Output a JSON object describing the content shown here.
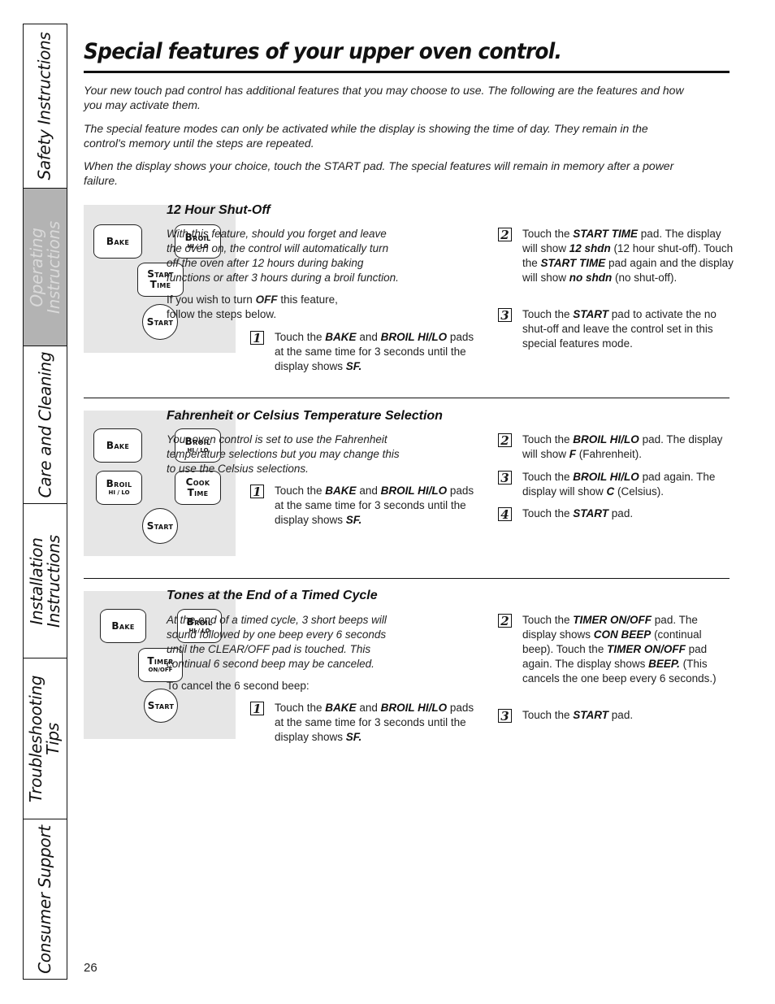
{
  "sidebar": {
    "tabs": [
      {
        "label": "Safety Instructions",
        "active": false
      },
      {
        "label": "Operating\nInstructions",
        "active": true
      },
      {
        "label": "Care and Cleaning",
        "active": false
      },
      {
        "label": "Installation\nInstructions",
        "active": false
      },
      {
        "label": "Troubleshooting\nTips",
        "active": false
      },
      {
        "label": "Consumer Support",
        "active": false
      }
    ]
  },
  "header": {
    "title": "Special features of your upper oven control."
  },
  "intro": {
    "p1": "Your new touch pad control has additional features that you may choose to use. The following are the features and how you may activate them.",
    "p2": "The special feature modes can only be activated while the display is showing the time of day. They remain in the control's memory until the steps are repeated.",
    "p3": "When the display shows your choice, touch the START pad. The special features will remain in memory after a power failure."
  },
  "sections": [
    {
      "title": "12 Hour Shut-Off",
      "pads": [
        {
          "main": "Bake",
          "sub": ""
        },
        {
          "main": "Broil",
          "sub": "HI / LO"
        },
        {
          "main": "Start Time",
          "sub": ""
        },
        {
          "main": "Start",
          "sub": ""
        }
      ],
      "description": "With this feature, should you forget and leave the oven on, the control will automatically turn off the oven after 12 hours during baking functions or after 3 hours during a broil function.",
      "note_pre": "If you wish to turn ",
      "note_bold": "OFF",
      "note_post": " this feature, follow the steps below.",
      "steps": [
        {
          "num": "1",
          "parts": [
            [
              "Touch the ",
              false
            ],
            [
              "BAKE",
              true
            ],
            [
              " and ",
              false
            ],
            [
              "BROIL HI/LO",
              true
            ],
            [
              " pads at the same time for 3 seconds until the display shows ",
              false
            ],
            [
              "SF.",
              true
            ]
          ]
        },
        {
          "num": "2",
          "parts": [
            [
              "Touch the ",
              false
            ],
            [
              "START TIME",
              true
            ],
            [
              " pad. The display will show ",
              false
            ],
            [
              "12 shdn",
              true
            ],
            [
              " (12 hour shut-off). Touch the ",
              false
            ],
            [
              "START TIME",
              true
            ],
            [
              " pad again and the display will show ",
              false
            ],
            [
              "no shdn",
              true
            ],
            [
              " (no shut-off).",
              false
            ]
          ]
        },
        {
          "num": "3",
          "parts": [
            [
              "Touch the ",
              false
            ],
            [
              "START",
              true
            ],
            [
              " pad to activate the no shut-off and leave the control set in this special features mode.",
              false
            ]
          ]
        }
      ]
    },
    {
      "title": "Fahrenheit or Celsius Temperature Selection",
      "pads": [
        {
          "main": "Bake",
          "sub": ""
        },
        {
          "main": "Broil",
          "sub": "HI / LO"
        },
        {
          "main": "Broil",
          "sub": "HI / LO"
        },
        {
          "main": "Cook Time",
          "sub": ""
        },
        {
          "main": "Start",
          "sub": ""
        }
      ],
      "description": "Your oven control is set to use the Fahrenheit temperature selections but you may change this to use the Celsius selections.",
      "steps": [
        {
          "num": "1",
          "parts": [
            [
              "Touch the ",
              false
            ],
            [
              "BAKE",
              true
            ],
            [
              " and ",
              false
            ],
            [
              "BROIL HI/LO",
              true
            ],
            [
              " pads at the same time for 3 seconds until the display shows ",
              false
            ],
            [
              "SF.",
              true
            ]
          ]
        },
        {
          "num": "2",
          "parts": [
            [
              "Touch the ",
              false
            ],
            [
              "BROIL HI/LO",
              true
            ],
            [
              " pad. The display will show ",
              false
            ],
            [
              "F",
              true
            ],
            [
              " (Fahrenheit).",
              false
            ]
          ]
        },
        {
          "num": "3",
          "parts": [
            [
              "Touch the ",
              false
            ],
            [
              "BROIL HI/LO",
              true
            ],
            [
              " pad again. The display will show ",
              false
            ],
            [
              "C",
              true
            ],
            [
              " (Celsius).",
              false
            ]
          ]
        },
        {
          "num": "4",
          "parts": [
            [
              "Touch the ",
              false
            ],
            [
              "START",
              true
            ],
            [
              " pad.",
              false
            ]
          ]
        }
      ]
    },
    {
      "title": "Tones at the End of a Timed Cycle",
      "pads": [
        {
          "main": "Bake",
          "sub": ""
        },
        {
          "main": "Broil",
          "sub": "HI / LO"
        },
        {
          "main": "Timer",
          "sub": "ON/OFF"
        },
        {
          "main": "Start",
          "sub": ""
        }
      ],
      "description": "At the end of a timed cycle, 3 short beeps will sound followed by one beep every 6 seconds until the CLEAR/OFF pad is touched. This continual 6 second beep may be canceled.",
      "note": "To cancel the 6 second beep:",
      "steps": [
        {
          "num": "1",
          "parts": [
            [
              "Touch the ",
              false
            ],
            [
              "BAKE",
              true
            ],
            [
              " and ",
              false
            ],
            [
              "BROIL HI/LO",
              true
            ],
            [
              " pads at the same time for 3 seconds until the display shows ",
              false
            ],
            [
              "SF.",
              true
            ]
          ]
        },
        {
          "num": "2",
          "parts": [
            [
              "Touch the ",
              false
            ],
            [
              "TIMER ON/OFF",
              true
            ],
            [
              " pad. The display shows ",
              false
            ],
            [
              "CON BEEP",
              true
            ],
            [
              " (continual beep). Touch the ",
              false
            ],
            [
              "TIMER ON/OFF",
              true
            ],
            [
              " pad again. The display shows ",
              false
            ],
            [
              "BEEP.",
              true
            ],
            [
              " (This cancels the one beep every 6 seconds.)",
              false
            ]
          ]
        },
        {
          "num": "3",
          "parts": [
            [
              "Touch the ",
              false
            ],
            [
              "START",
              true
            ],
            [
              " pad.",
              false
            ]
          ]
        }
      ]
    }
  ],
  "footer": {
    "page_number": "26"
  }
}
